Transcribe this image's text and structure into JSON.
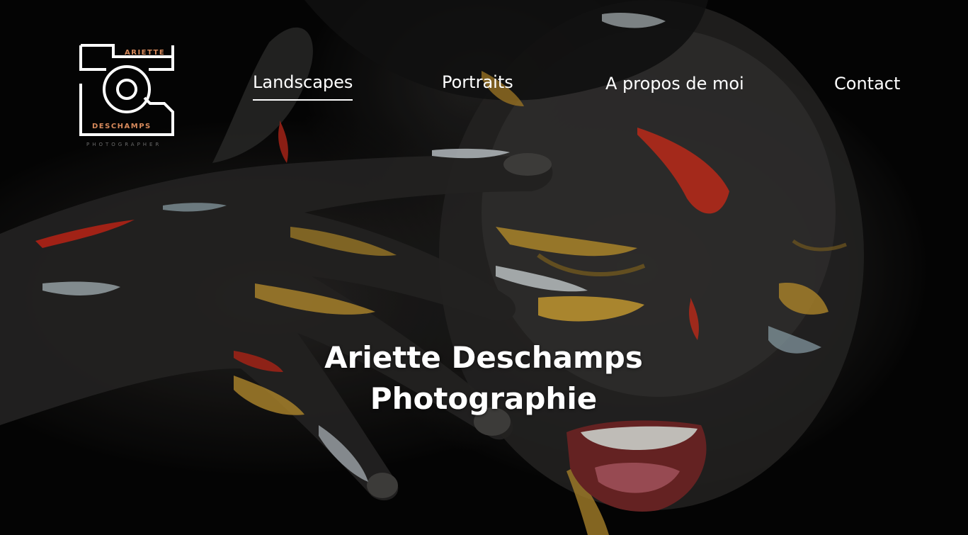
{
  "brand": {
    "name_top": "ARIETTE",
    "name_bottom": "DESCHAMPS",
    "tagline": "PHOTOGRAPHER",
    "logo_icon": "camera-logo-icon",
    "accent_color": "#d88a5c"
  },
  "nav": {
    "items": [
      {
        "label": "Landscapes",
        "active": true
      },
      {
        "label": "Portraits",
        "active": false
      },
      {
        "label": "A propos de moi",
        "active": false
      },
      {
        "label": "Contact",
        "active": false
      }
    ]
  },
  "hero": {
    "title_line1": "Ariette Deschamps",
    "title_line2": "Photographie",
    "background_image": "woman-with-painted-face-photo"
  }
}
